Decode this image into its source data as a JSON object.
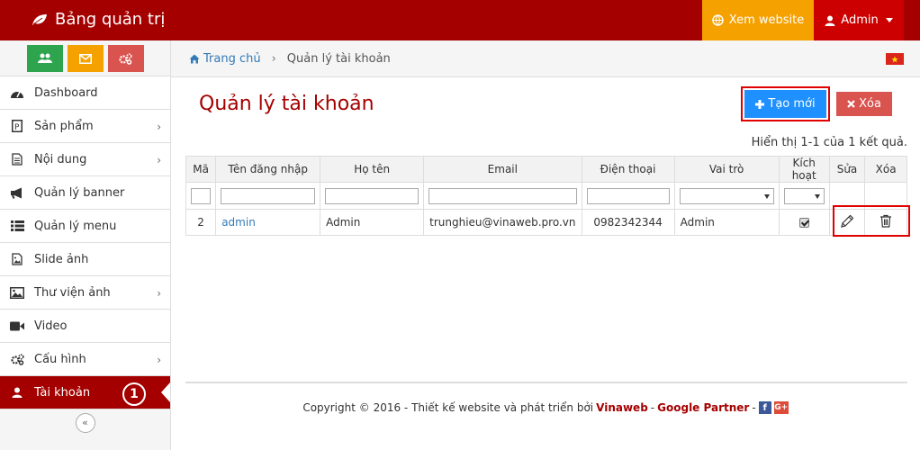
{
  "header": {
    "brand": "Bảng quản trị",
    "view_website": "Xem website",
    "admin": "Admin"
  },
  "sidebar": {
    "items": [
      {
        "label": "Dashboard"
      },
      {
        "label": "Sản phẩm"
      },
      {
        "label": "Nội dung"
      },
      {
        "label": "Quản lý banner"
      },
      {
        "label": "Quản lý menu"
      },
      {
        "label": "Slide ảnh"
      },
      {
        "label": "Thư viện ảnh"
      },
      {
        "label": "Video"
      },
      {
        "label": "Cấu hình"
      },
      {
        "label": "Tài khoản"
      }
    ],
    "badge": "1",
    "collapse": "«"
  },
  "breadcrumb": {
    "home": "Trang chủ",
    "current": "Quản lý tài khoản"
  },
  "main": {
    "title": "Quản lý tài khoản",
    "create_label": "Tạo mới",
    "delete_label": "Xóa",
    "result_count": "Hiển thị 1-1 của 1 kết quả."
  },
  "table": {
    "headers": [
      "Mã",
      "Tên đăng nhập",
      "Họ tên",
      "Email",
      "Điện thoại",
      "Vai trò",
      "Kích hoạt",
      "Sửa",
      "Xóa"
    ],
    "rows": [
      {
        "id": "2",
        "username": "admin",
        "fullname": "Admin",
        "email": "trunghieu@vinaweb.pro.vn",
        "phone": "0982342344",
        "role": "Admin",
        "active": true
      }
    ]
  },
  "footer": {
    "copyright": "Copyright © 2016 - Thiết kế website và phát triển bởi",
    "vinaweb": "Vinaweb",
    "dash": "-",
    "partner": "Google Partner",
    "dash2": "-",
    "fb": "f",
    "gplus": "G+"
  },
  "colors": {
    "primary": "#a50000",
    "accent": "#f5a100",
    "blue": "#1e90ff",
    "danger": "#d9534f"
  }
}
